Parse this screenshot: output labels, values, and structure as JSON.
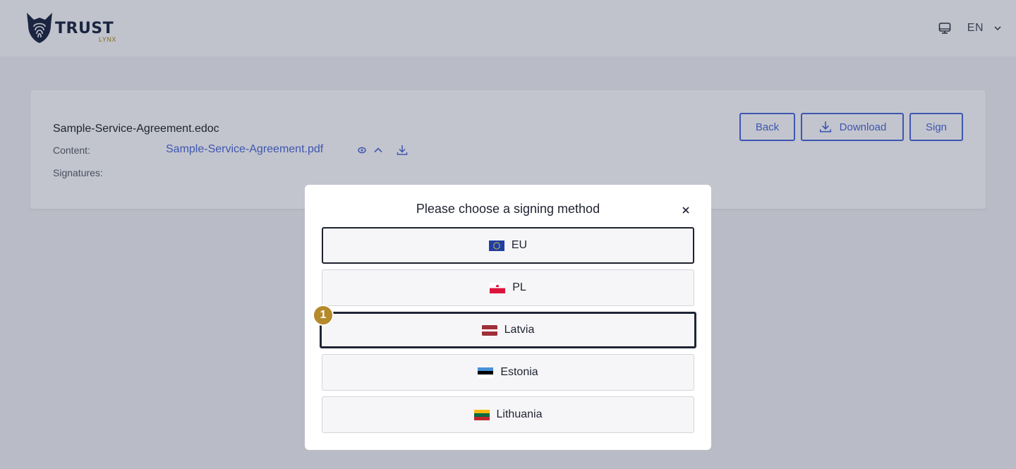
{
  "header": {
    "brand": "TRUST",
    "brand_sub": "LYNX",
    "language": "EN"
  },
  "document": {
    "file_name": "Sample-Service-Agreement.edoc",
    "content_label": "Content:",
    "content_file": "Sample-Service-Agreement.pdf",
    "signatures_label": "Signatures:"
  },
  "actions": {
    "back": "Back",
    "download": "Download",
    "sign": "Sign"
  },
  "modal": {
    "title": "Please choose a signing method",
    "close_symbol": "×",
    "options": [
      {
        "label": "EU",
        "flag": "eu-flag-icon"
      },
      {
        "label": "PL",
        "flag": "poland-flag-icon"
      },
      {
        "label": "Latvia",
        "flag": "latvia-flag-icon"
      },
      {
        "label": "Estonia",
        "flag": "estonia-flag-icon"
      },
      {
        "label": "Lithuania",
        "flag": "lithuania-flag-icon"
      }
    ],
    "step_badge": "1"
  },
  "colors": {
    "accent": "#3f56b0",
    "badge": "#b58a2b",
    "overlay_bg": "#b9bcc6"
  }
}
